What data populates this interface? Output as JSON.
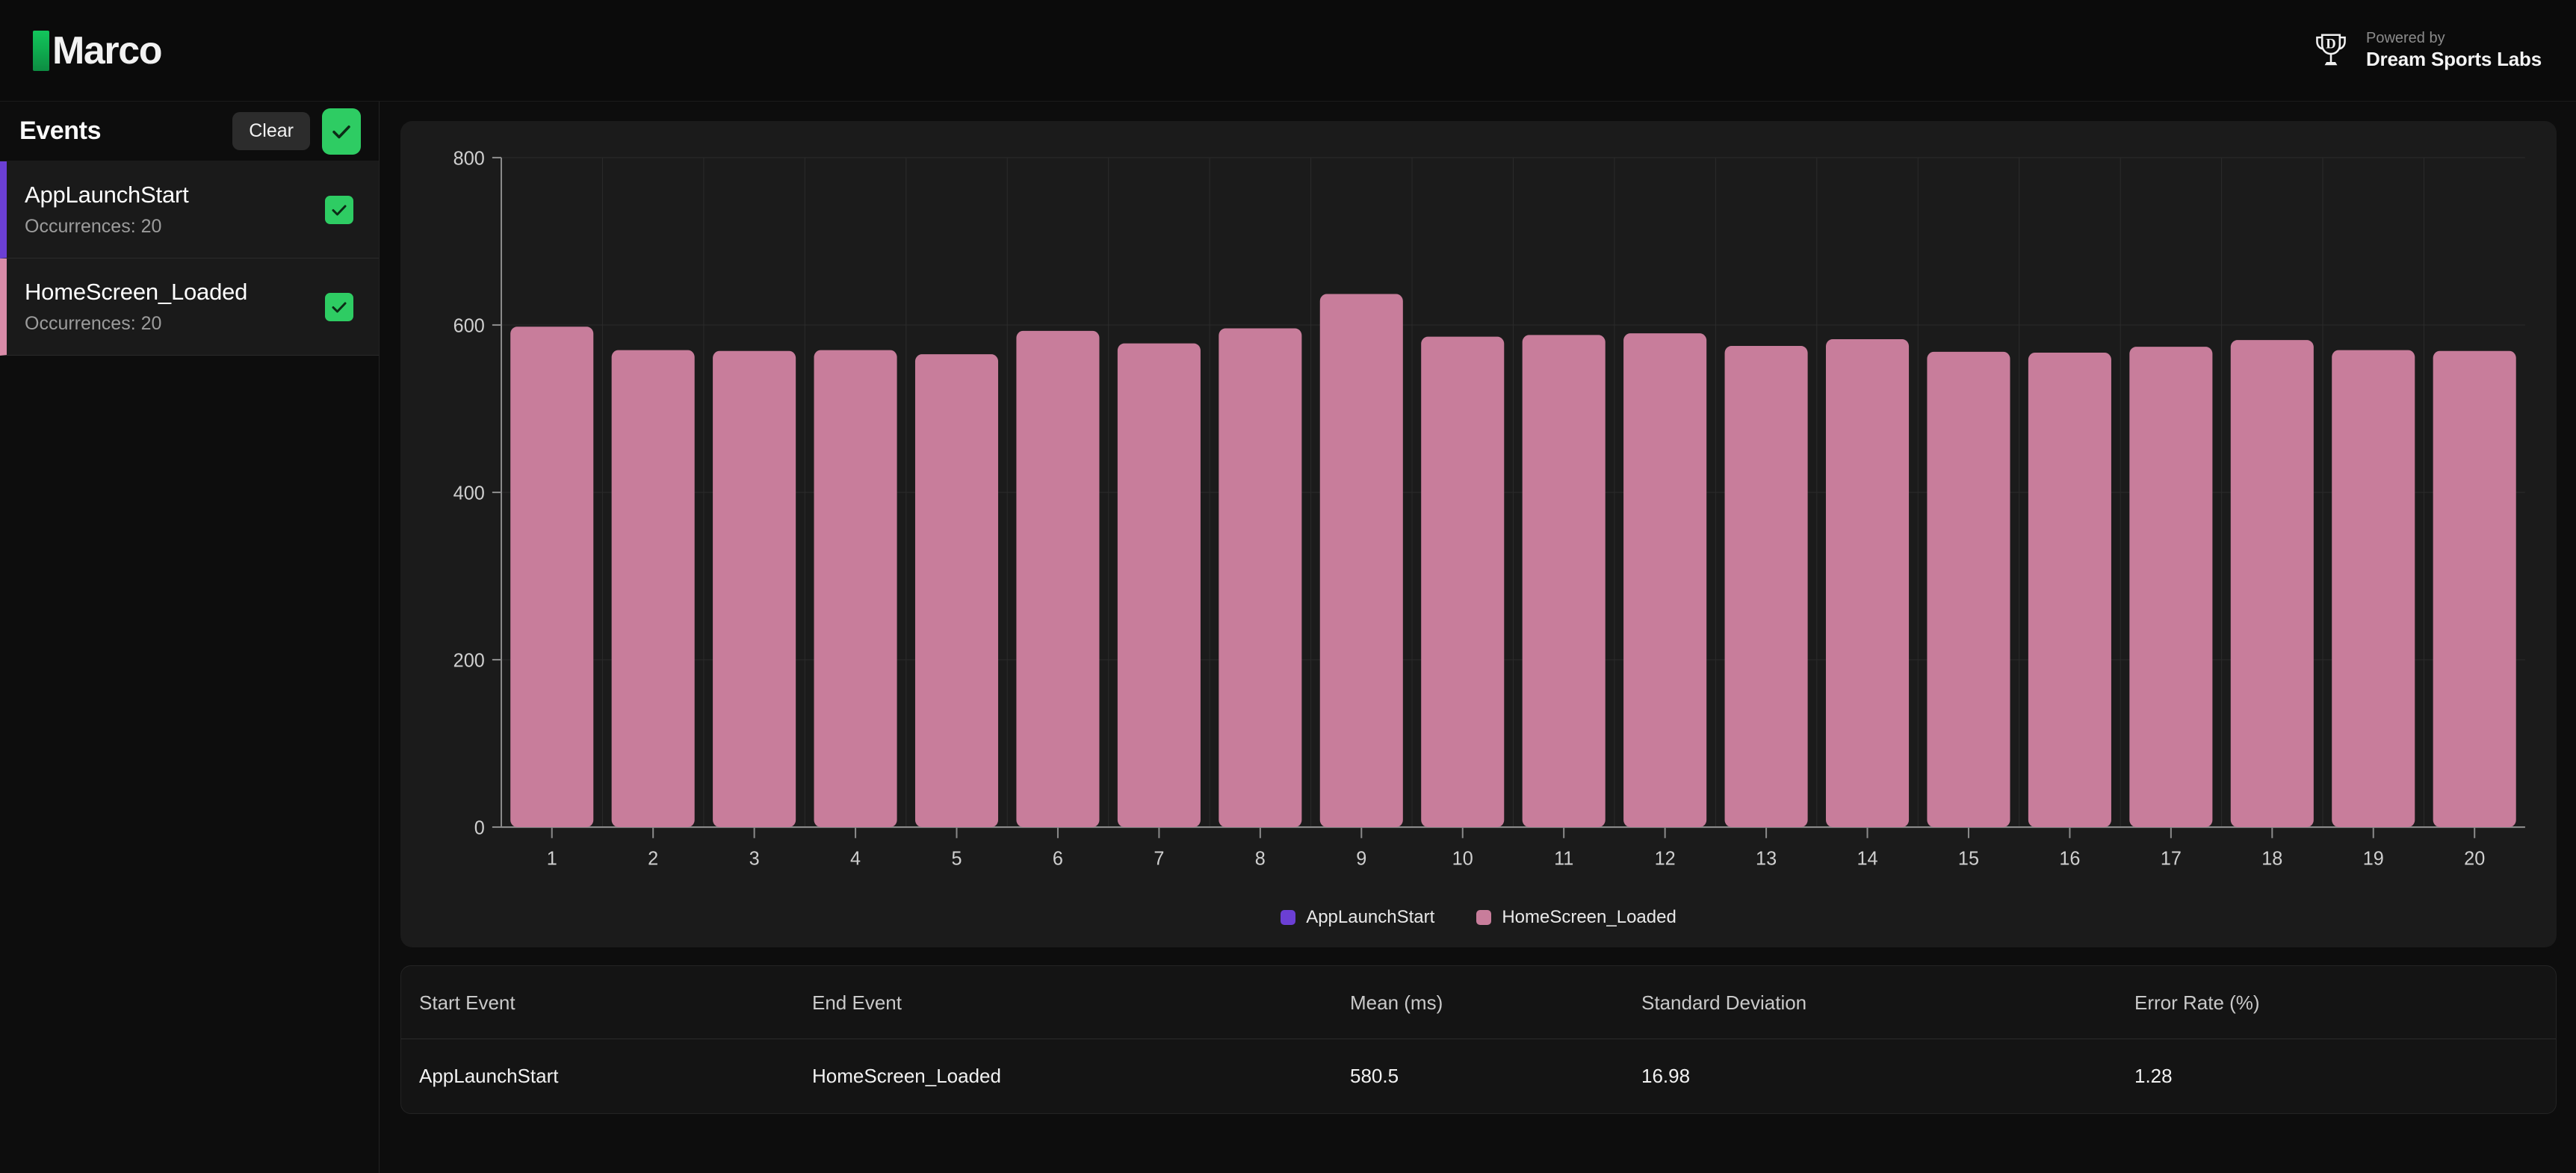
{
  "header": {
    "brand_name": "Marco",
    "brand_accent_color": "#13c55c",
    "powered_label": "Powered by",
    "powered_brand": "Dream Sports Labs",
    "trophy_letter": "D"
  },
  "sidebar": {
    "title": "Events",
    "clear_label": "Clear",
    "select_all_checked": true,
    "items": [
      {
        "name": "AppLaunchStart",
        "occurrences": "Occurrences: 20",
        "accent": "#6b3fd4",
        "checked": true
      },
      {
        "name": "HomeScreen_Loaded",
        "occurrences": "Occurrences: 20",
        "accent": "#d98ba8",
        "checked": true
      }
    ]
  },
  "chart_data": {
    "type": "bar",
    "title": "",
    "xlabel": "",
    "ylabel": "",
    "ylim": [
      0,
      800
    ],
    "yticks": [
      0,
      200,
      400,
      600,
      800
    ],
    "grid": true,
    "legend_position": "bottom",
    "categories": [
      "1",
      "2",
      "3",
      "4",
      "5",
      "6",
      "7",
      "8",
      "9",
      "10",
      "11",
      "12",
      "13",
      "14",
      "15",
      "16",
      "17",
      "18",
      "19",
      "20"
    ],
    "series": [
      {
        "name": "AppLaunchStart",
        "color": "#6b3fd4",
        "values": [
          0,
          0,
          0,
          0,
          0,
          0,
          0,
          0,
          0,
          0,
          0,
          0,
          0,
          0,
          0,
          0,
          0,
          0,
          0,
          0
        ]
      },
      {
        "name": "HomeScreen_Loaded",
        "color": "#c87d9b",
        "values": [
          598,
          570,
          569,
          570,
          565,
          593,
          578,
          596,
          637,
          586,
          588,
          590,
          575,
          583,
          568,
          567,
          574,
          582,
          570,
          569
        ]
      }
    ]
  },
  "table": {
    "columns": [
      "Start Event",
      "End Event",
      "Mean (ms)",
      "Standard Deviation",
      "Error Rate (%)"
    ],
    "rows": [
      {
        "start_event": "AppLaunchStart",
        "end_event": "HomeScreen_Loaded",
        "mean_ms": "580.5",
        "std_dev": "16.98",
        "error_rate": "1.28"
      }
    ]
  }
}
